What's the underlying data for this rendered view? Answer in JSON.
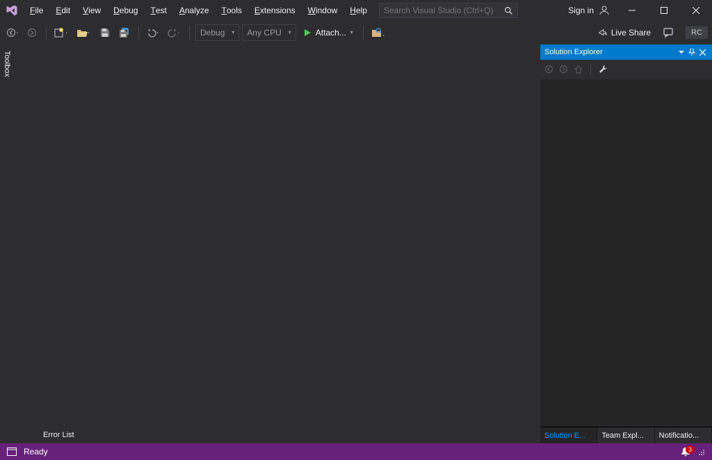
{
  "menubar": {
    "items": [
      {
        "label": "File",
        "accel": "F"
      },
      {
        "label": "Edit",
        "accel": "E"
      },
      {
        "label": "View",
        "accel": "V"
      },
      {
        "label": "Debug",
        "accel": "D"
      },
      {
        "label": "Test",
        "accel": "T"
      },
      {
        "label": "Analyze",
        "accel": "A"
      },
      {
        "label": "Tools",
        "accel": "T"
      },
      {
        "label": "Extensions",
        "accel": "E"
      },
      {
        "label": "Window",
        "accel": "W"
      },
      {
        "label": "Help",
        "accel": "H"
      }
    ]
  },
  "search": {
    "placeholder": "Search Visual Studio (Ctrl+Q)"
  },
  "signin": {
    "label": "Sign in"
  },
  "toolbar": {
    "config": "Debug",
    "platform": "Any CPU",
    "attach": "Attach...",
    "liveshare": "Live Share",
    "rc": "RC"
  },
  "toolbox": {
    "label": "Toolbox"
  },
  "errorlist": {
    "label": "Error List"
  },
  "solution": {
    "title": "Solution Explorer",
    "tabs": [
      "Solution E...",
      "Team Expl...",
      "Notificatio..."
    ],
    "active_tab": 0
  },
  "statusbar": {
    "status": "Ready",
    "notifications": "3"
  }
}
